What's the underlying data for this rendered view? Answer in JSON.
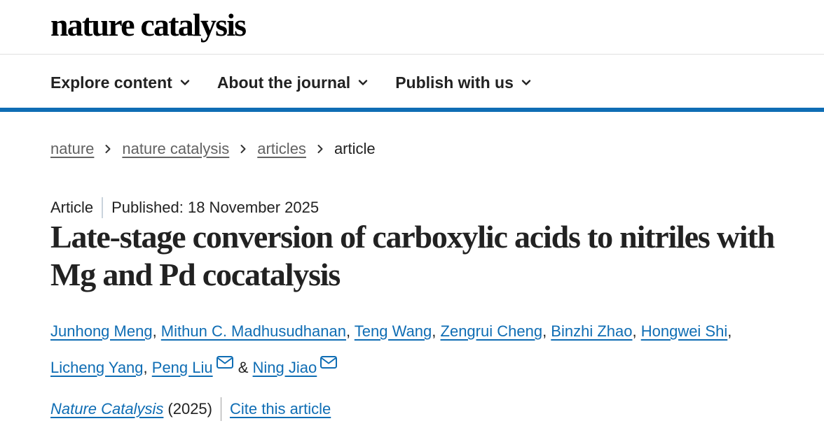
{
  "header": {
    "logo": "nature catalysis"
  },
  "nav": {
    "items": [
      {
        "label": "Explore content",
        "icon": "chevron-down-icon"
      },
      {
        "label": "About the journal",
        "icon": "chevron-down-icon"
      },
      {
        "label": "Publish with us",
        "icon": "chevron-down-icon"
      }
    ]
  },
  "breadcrumb": {
    "items": [
      {
        "label": "nature"
      },
      {
        "label": "nature catalysis"
      },
      {
        "label": "articles"
      },
      {
        "label": "article"
      }
    ],
    "separator_icon": "chevron-right-icon"
  },
  "article": {
    "type": "Article",
    "published": "Published: 18 November 2025",
    "title": "Late-stage conversion of carboxylic acids to nitriles with Mg and Pd cocatalysis",
    "authors": [
      "Junhong Meng",
      "Mithun C. Madhusudhanan",
      "Teng Wang",
      "Zengrui Cheng",
      "Binzhi Zhao",
      "Hongwei Shi",
      "Licheng Yang",
      "Peng Liu",
      "Ning Jiao"
    ],
    "author_separator": ", ",
    "author_last_join": " & ",
    "journal": "Nature Catalysis",
    "year": "(2025)",
    "cite_label": "Cite this article"
  },
  "colors": {
    "link": "#0f6db4",
    "nav_border": "#0f6db4",
    "text": "#222222",
    "muted": "#626262"
  }
}
